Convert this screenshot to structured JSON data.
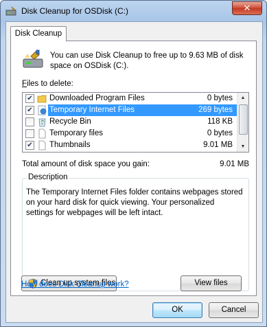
{
  "window": {
    "title": "Disk Cleanup for OSDisk (C:)"
  },
  "tab": {
    "label": "Disk Cleanup"
  },
  "intro": {
    "text": "You can use Disk Cleanup to free up to 9.63 MB of disk space on OSDisk (C:)."
  },
  "files_to_delete": {
    "label_accel": "F",
    "label_rest": "iles to delete:",
    "items": [
      {
        "name": "Downloaded Program Files",
        "size": "0 bytes",
        "checked": true,
        "selected": false,
        "icon": "folder-icon"
      },
      {
        "name": "Temporary Internet Files",
        "size": "269 bytes",
        "checked": true,
        "selected": true,
        "icon": "internet-files-icon"
      },
      {
        "name": "Recycle Bin",
        "size": "118 KB",
        "checked": false,
        "selected": false,
        "icon": "recycle-bin-icon"
      },
      {
        "name": "Temporary files",
        "size": "0 bytes",
        "checked": false,
        "selected": false,
        "icon": "file-icon"
      },
      {
        "name": "Thumbnails",
        "size": "9.01 MB",
        "checked": true,
        "selected": false,
        "icon": "file-icon"
      }
    ]
  },
  "total": {
    "label": "Total amount of disk space you gain:",
    "value": "9.01 MB"
  },
  "description": {
    "legend": "Description",
    "text": "The Temporary Internet Files folder contains webpages stored on your hard disk for quick viewing. Your personalized settings for webpages will be left intact."
  },
  "buttons": {
    "cleanup_system": "Clean up system files",
    "view_files": "View files",
    "ok": "OK",
    "cancel": "Cancel"
  },
  "help_link": "How does Disk Cleanup work?",
  "colors": {
    "selection": "#3399ff",
    "link": "#0066cc",
    "title_gradient_top": "#bcd4ee"
  }
}
